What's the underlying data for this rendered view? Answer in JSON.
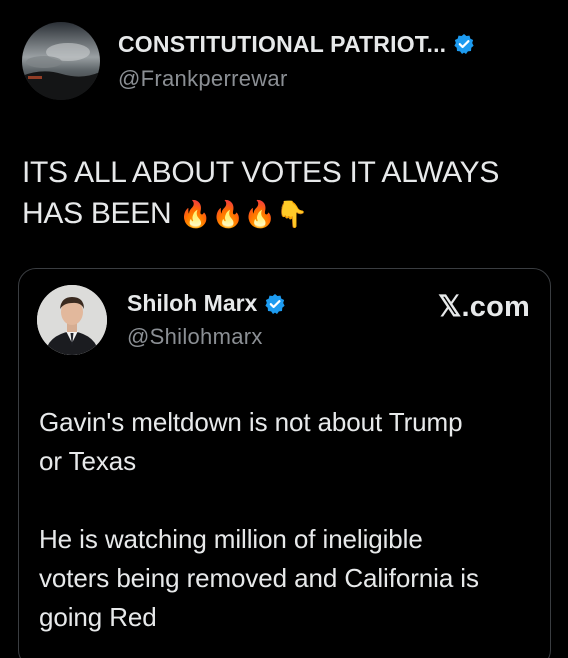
{
  "author": {
    "display_name": "CONSTITUTIONAL PATRIOT...",
    "handle": "@Frankperrewar",
    "verified": true
  },
  "tweet": {
    "lines": [
      "ITS ALL ABOUT VOTES IT ALWAYS",
      "HAS BEEN"
    ],
    "emojis": "🔥🔥🔥👇"
  },
  "quoted": {
    "display_name": "Shiloh Marx",
    "handle": "@Shilohmarx",
    "verified": true,
    "brand": "𝕏.com",
    "paragraphs": [
      [
        "Gavin's meltdown is not about Trump",
        "or Texas"
      ],
      [
        "He is watching million of ineligible",
        "voters being removed and California is",
        "going Red"
      ]
    ]
  },
  "colors": {
    "background": "#000000",
    "text": "#e7e9ea",
    "secondary": "#8b8f94",
    "verified_blue": "#1d9bf0",
    "card_border": "#3a3d41"
  }
}
